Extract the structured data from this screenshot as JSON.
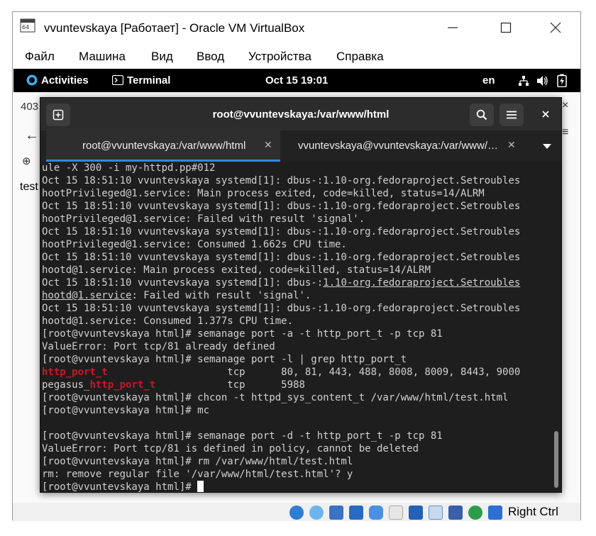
{
  "window": {
    "title": "vvuntevskaya [Работает] - Oracle VM VirtualBox",
    "minimize_label": "—",
    "maximize_label": "☐",
    "close_label": "✕"
  },
  "menu": [
    "Файл",
    "Машина",
    "Вид",
    "Ввод",
    "Устройства",
    "Справка"
  ],
  "gnome": {
    "activities": "Activities",
    "app": "Terminal",
    "clock": "Oct 15  19:01",
    "lang": "en"
  },
  "background": {
    "tab_fragment": "403",
    "page_text": "test"
  },
  "terminal": {
    "title": "root@vvuntevskaya:/var/www/html",
    "tabs": [
      {
        "label": "root@vvuntevskaya:/var/www/html",
        "active": true
      },
      {
        "label": "vvuntevskaya@vvuntevskaya:/var/www/…",
        "active": false
      }
    ],
    "lines": [
      [
        {
          "t": "ule -X 300 -i my-httpd.pp#012"
        }
      ],
      [
        {
          "t": "Oct 15 18:51:10 vvuntevskaya systemd[1]: dbus-:1.10-org.fedoraproject.Setroubles"
        }
      ],
      [
        {
          "t": "hootPrivileged@1.service: Main process exited, code=killed, status=14/ALRM"
        }
      ],
      [
        {
          "t": "Oct 15 18:51:10 vvuntevskaya systemd[1]: dbus-:1.10-org.fedoraproject.Setroubles"
        }
      ],
      [
        {
          "t": "hootPrivileged@1.service: Failed with result 'signal'."
        }
      ],
      [
        {
          "t": "Oct 15 18:51:10 vvuntevskaya systemd[1]: dbus-:1.10-org.fedoraproject.Setroubles"
        }
      ],
      [
        {
          "t": "hootPrivileged@1.service: Consumed 1.662s CPU time."
        }
      ],
      [
        {
          "t": "Oct 15 18:51:10 vvuntevskaya systemd[1]: dbus-:1.10-org.fedoraproject.Setroubles"
        }
      ],
      [
        {
          "t": "hootd@1.service: Main process exited, code=killed, status=14/ALRM"
        }
      ],
      [
        {
          "t": "Oct 15 18:51:10 vvuntevskaya systemd[1]: dbus-:"
        },
        {
          "t": "1.10-org.fedoraproject.Setroubles",
          "c": "ul"
        }
      ],
      [
        {
          "t": "hootd@1.service",
          "c": "ul"
        },
        {
          "t": ": Failed with result 'signal'."
        }
      ],
      [
        {
          "t": "Oct 15 18:51:10 vvuntevskaya systemd[1]: dbus-:1.10-org.fedoraproject.Setroubles"
        }
      ],
      [
        {
          "t": "hootd@1.service: Consumed 1.377s CPU time."
        }
      ],
      [
        {
          "t": "[root@vvuntevskaya html]# semanage port -a -t http_port_t -p tcp 81"
        }
      ],
      [
        {
          "t": "ValueError: Port tcp/81 already defined"
        }
      ],
      [
        {
          "t": "[root@vvuntevskaya html]# semanage port -l | grep http_port_t"
        }
      ],
      [
        {
          "t": "http_port_t",
          "c": "red"
        },
        {
          "t": "                    tcp      80, 81, 443, 488, 8008, 8009, 8443, 9000"
        }
      ],
      [
        {
          "t": "pegasus_"
        },
        {
          "t": "http_port_t",
          "c": "red"
        },
        {
          "t": "            tcp      5988"
        }
      ],
      [
        {
          "t": "[root@vvuntevskaya html]# chcon -t httpd_sys_content_t /var/www/html/test.html"
        }
      ],
      [
        {
          "t": "[root@vvuntevskaya html]# mc"
        }
      ],
      [
        {
          "t": ""
        }
      ],
      [
        {
          "t": "[root@vvuntevskaya html]# semanage port -d -t http_port_t -p tcp 81"
        }
      ],
      [
        {
          "t": "ValueError: Port tcp/81 is defined in policy, cannot be deleted"
        }
      ],
      [
        {
          "t": "[root@vvuntevskaya html]# rm /var/www/html/test.html"
        }
      ],
      [
        {
          "t": "rm: remove regular file '/var/www/html/test.html'? y"
        }
      ],
      [
        {
          "t": "[root@vvuntevskaya html]# "
        },
        {
          "t": "",
          "c": "cursor"
        }
      ]
    ]
  },
  "statusbar": {
    "host_key": "Right Ctrl"
  },
  "colors": {
    "term_bg": "#1e1e1e",
    "term_fg": "#d0d0d0",
    "highlight_red": "#c01c28",
    "tab_accent": "#3584e4"
  }
}
